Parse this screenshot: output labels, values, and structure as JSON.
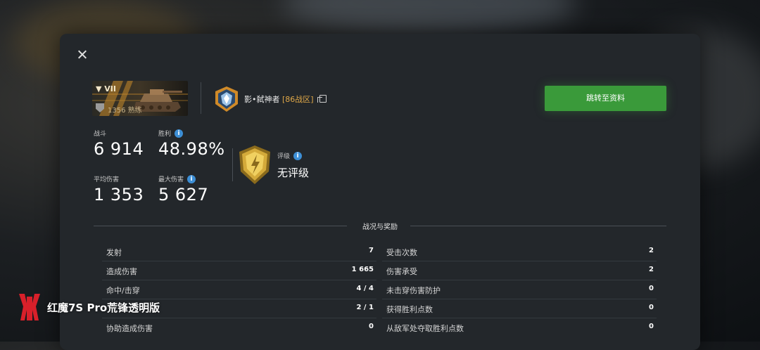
{
  "player": {
    "name": "影•弑神者",
    "server": "[86战区]"
  },
  "tank": {
    "tier": "▼ VII",
    "meta": "1356 熟练"
  },
  "goto_button": "跳转至资料",
  "stats": {
    "battles_label": "战斗",
    "battles_value": "6 914",
    "winrate_label": "胜利",
    "winrate_value": "48.98%",
    "avg_damage_label": "平均伤害",
    "avg_damage_value": "1 353",
    "max_damage_label": "最大伤害",
    "max_damage_value": "5 627",
    "rating_label": "评级",
    "rating_value": "无评级"
  },
  "section_title": "战况与奖励",
  "table_left": [
    {
      "label": "发射",
      "value": "7"
    },
    {
      "label": "造成伤害",
      "value": "1 665"
    },
    {
      "label": "命中/击穿",
      "value": "4 / 4"
    },
    {
      "label": "",
      "value": "2 / 1"
    },
    {
      "label": "协助造成伤害",
      "value": "0"
    }
  ],
  "table_right": [
    {
      "label": "受击次数",
      "value": "2"
    },
    {
      "label": "伤害承受",
      "value": "2"
    },
    {
      "label": "未击穿伤害防护",
      "value": "0"
    },
    {
      "label": "获得胜利点数",
      "value": "0"
    },
    {
      "label": "从敌军处夺取胜利点数",
      "value": "0"
    }
  ],
  "watermark": "红魔7S Pro荒锋透明版",
  "colors": {
    "accent_green": "#3a9a3a",
    "server_orange": "#e0a848",
    "info_blue": "#3d8fd6"
  }
}
